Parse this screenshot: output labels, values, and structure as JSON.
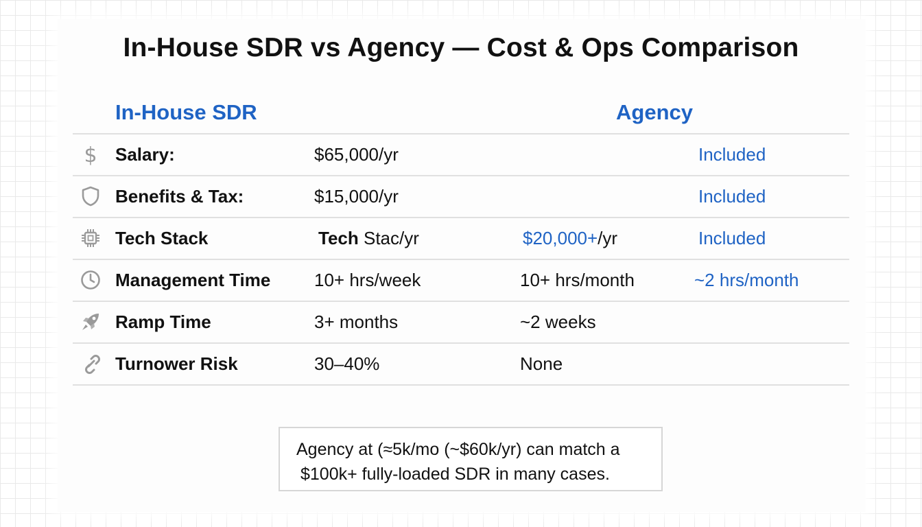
{
  "title": "In-House SDR vs Agency — Cost & Ops Comparison",
  "columns": {
    "inhouse": "In-House SDR",
    "agency": "Agency"
  },
  "rows": [
    {
      "icon": "dollar-icon",
      "label": "Salary:",
      "inhouse": "$65,000/yr",
      "mid": "",
      "agency": "Included"
    },
    {
      "icon": "shield-icon",
      "label": "Benefits & Tax:",
      "inhouse": "$15,000/yr",
      "mid": "",
      "agency": "Included"
    },
    {
      "icon": "chip-icon",
      "label": "Tech Stack",
      "inhouse_bold": "Tech",
      "inhouse_rest": " Stac/yr",
      "mid_blue": "$20,000+",
      "mid_rest": "/yr",
      "agency": "Included"
    },
    {
      "icon": "clock-icon",
      "label": "Management Time",
      "inhouse": "10+ hrs/week",
      "mid": "10+ hrs/month",
      "agency": "~2 hrs/month"
    },
    {
      "icon": "rocket-icon",
      "label": "Ramp Time",
      "inhouse": "3+ months",
      "mid": "~2 weeks",
      "agency": ""
    },
    {
      "icon": "link-icon",
      "label": "Turnower Risk",
      "inhouse": "30–40%",
      "mid": "None",
      "agency": ""
    }
  ],
  "note": {
    "line1": "Agency at (≈5k/mo (~$60k/yr) can match a",
    "line2": "$100k+ fully-loaded SDR in many cases."
  },
  "colors": {
    "accent": "#1f63c4",
    "text": "#111111",
    "rule": "#e0e0e0"
  }
}
